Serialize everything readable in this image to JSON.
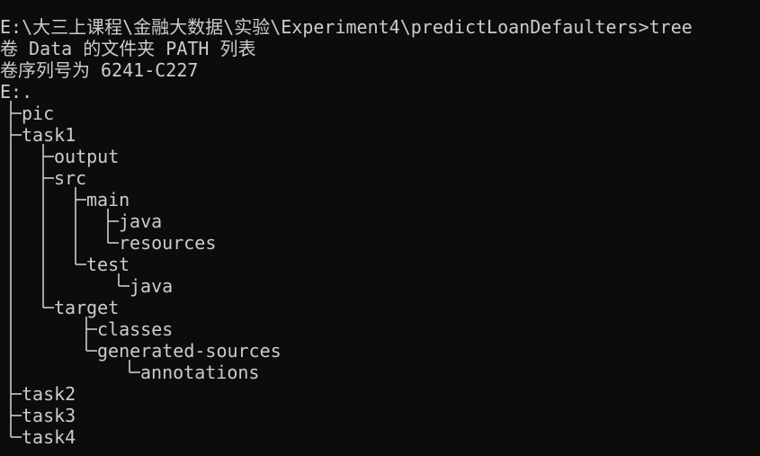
{
  "terminal": {
    "header_lines": [
      "E:\\大三上课程\\金融大数据\\实验\\Experiment4\\predictLoanDefaulters>tree",
      "卷 Data 的文件夹 PATH 列表",
      "卷序列号为 6241-C227",
      "E:."
    ],
    "tree": {
      "pic": "pic",
      "task1": "task1",
      "output": "output",
      "src": "src",
      "main": "main",
      "main_java": "java",
      "resources": "resources",
      "test": "test",
      "test_java": "java",
      "target": "target",
      "classes": "classes",
      "generated_sources": "generated-sources",
      "annotations": "annotations",
      "task2": "task2",
      "task3": "task3",
      "task4": "task4"
    }
  }
}
